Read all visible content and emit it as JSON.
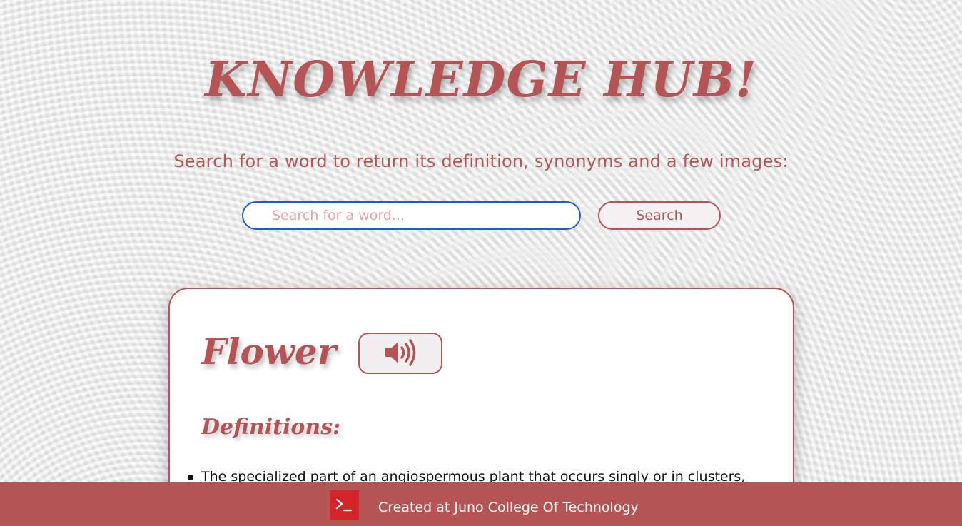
{
  "header": {
    "title": "KNOWLEDGE HUB!",
    "subtitle": "Search for a word to return its definition, synonyms and a few images:"
  },
  "search": {
    "placeholder": "Search for a word...",
    "value": "",
    "button_label": "Search"
  },
  "result": {
    "word": "Flower",
    "audio_icon": "speaker-volume-icon",
    "definitions_heading": "Definitions:",
    "definitions": [
      "The specialized part of an angiospermous plant that occurs singly or in clusters,"
    ]
  },
  "footer": {
    "icon": "terminal-icon",
    "text": "Created at Juno College Of Technology"
  },
  "colors": {
    "accent": "#b55454",
    "input_border": "#1d5fc9",
    "footer_icon_bg": "#d42428",
    "background": "#ededed"
  }
}
